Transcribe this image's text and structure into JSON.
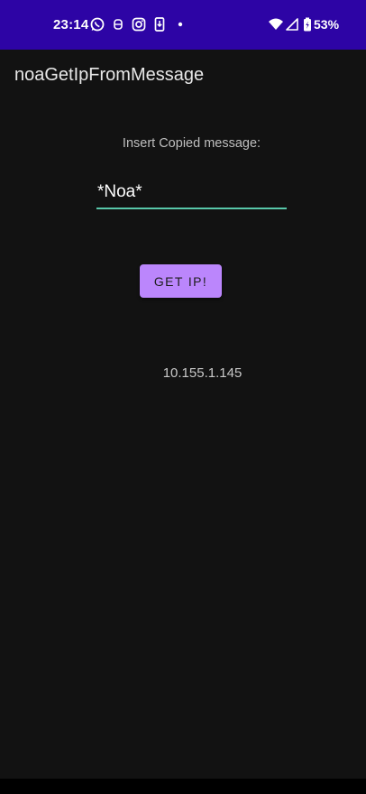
{
  "status_bar": {
    "time": "23:14",
    "battery_percent": "53%",
    "background": "#2d04a5",
    "icons": [
      "whatsapp-icon",
      "messenger-icon",
      "instagram-icon",
      "phone-save-icon",
      "dot-icon",
      "wifi-icon",
      "signal-icon",
      "battery-icon"
    ]
  },
  "app": {
    "title": "noaGetIpFromMessage"
  },
  "main": {
    "prompt_label": "Insert Copied message:",
    "message_input": {
      "value": "*Noa*",
      "placeholder": ""
    },
    "button_label": "GET IP!",
    "result_ip": "10.155.1.145"
  },
  "colors": {
    "background": "#121212",
    "accent": "#bb86fc",
    "input_underline": "#58c7a9"
  }
}
